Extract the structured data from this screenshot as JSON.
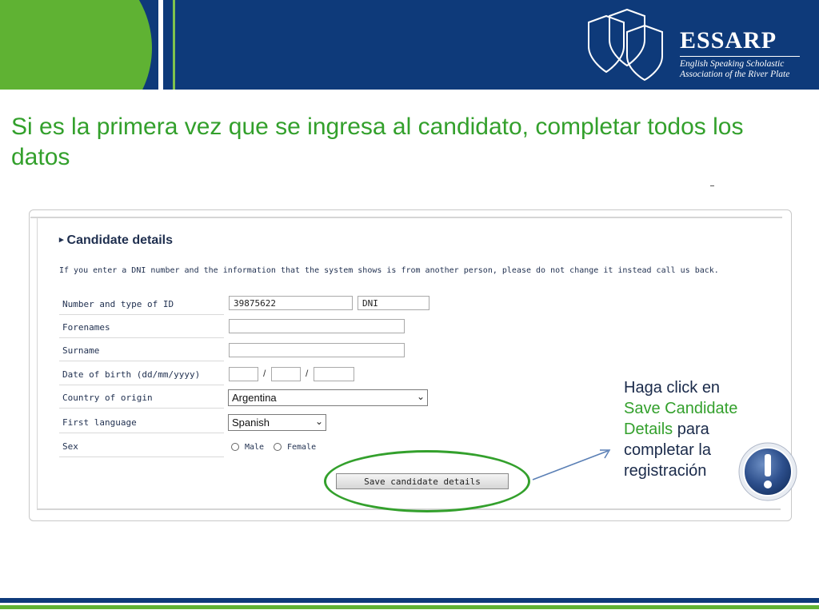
{
  "logo": {
    "name": "ESSARP",
    "tagline_line1": "English Speaking Scholastic",
    "tagline_line2": "Association of the River Plate"
  },
  "headline": "Si es la primera vez que se ingresa al candidato, completar todos los datos",
  "form": {
    "section_title": "Candidate details",
    "notice": "If you enter a DNI number and the information that the system shows is from another person, please do not change it instead call us back.",
    "fields": {
      "id": {
        "label": "Number and type of ID",
        "number_value": "39875622",
        "type_value": "DNI"
      },
      "forenames": {
        "label": "Forenames",
        "value": ""
      },
      "surname": {
        "label": "Surname",
        "value": ""
      },
      "dob": {
        "label": "Date of birth (dd/mm/yyyy)",
        "day": "",
        "month": "",
        "year": "",
        "separator": "/"
      },
      "country": {
        "label": "Country of origin",
        "selected": "Argentina"
      },
      "language": {
        "label": "First language",
        "selected": "Spanish"
      },
      "sex": {
        "label": "Sex",
        "option_male": "Male",
        "option_female": "Female"
      }
    },
    "save_label": "Save candidate details"
  },
  "callout": {
    "line1": "Haga click en",
    "highlight": "Save Candidate Details",
    "rest": "para completar la registración"
  },
  "colors": {
    "brand_blue": "#0e3a7a",
    "brand_green": "#5fb233",
    "headline_green": "#33a02c"
  },
  "icons": [
    "shield-logo-icon",
    "chevron-down-icon",
    "alert-icon"
  ]
}
